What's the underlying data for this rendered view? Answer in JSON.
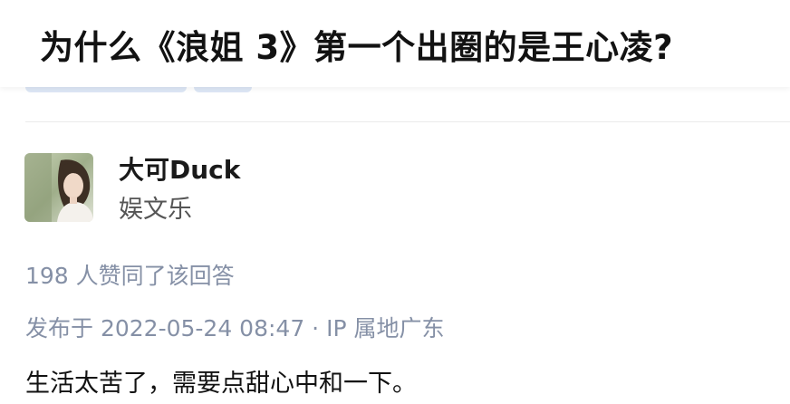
{
  "question": {
    "title": "为什么《浪姐 3》第一个出圈的是王心凌?"
  },
  "author": {
    "name": "大可Duck",
    "tag": "娱文乐",
    "avatar_icon": "avatar-photo"
  },
  "answer": {
    "vote_text": "198 人赞同了该回答",
    "publish_text": "发布于 2022-05-24 08:47 · IP 属地广东",
    "content": "生活太苦了，需要点甜心中和一下。"
  },
  "colors": {
    "title": "#121212",
    "meta": "#8590a6",
    "chip": "#dde6f5"
  }
}
